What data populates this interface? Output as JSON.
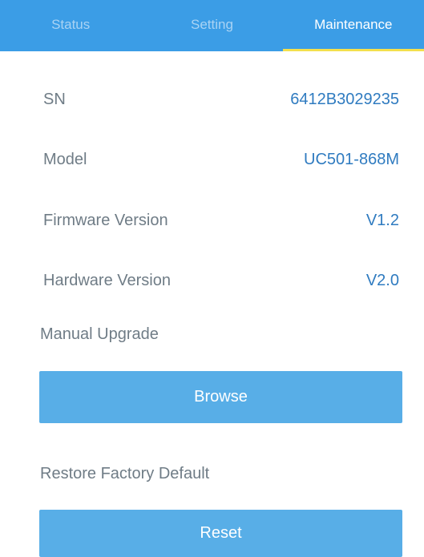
{
  "tabs": [
    {
      "label": "Status"
    },
    {
      "label": "Setting"
    },
    {
      "label": "Maintenance"
    }
  ],
  "info": {
    "sn": {
      "label": "SN",
      "value": "6412B3029235"
    },
    "model": {
      "label": "Model",
      "value": "UC501-868M"
    },
    "firmware": {
      "label": "Firmware Version",
      "value": "V1.2"
    },
    "hardware": {
      "label": "Hardware Version",
      "value": "V2.0"
    }
  },
  "upgrade": {
    "heading": "Manual Upgrade",
    "button": "Browse"
  },
  "restore": {
    "heading": "Restore Factory Default",
    "button": "Reset"
  },
  "colors": {
    "tab_bg": "#3b9de6",
    "active_indicator": "#f4e04d",
    "button_bg": "#58aee7",
    "value_text": "#2f7bc0"
  }
}
